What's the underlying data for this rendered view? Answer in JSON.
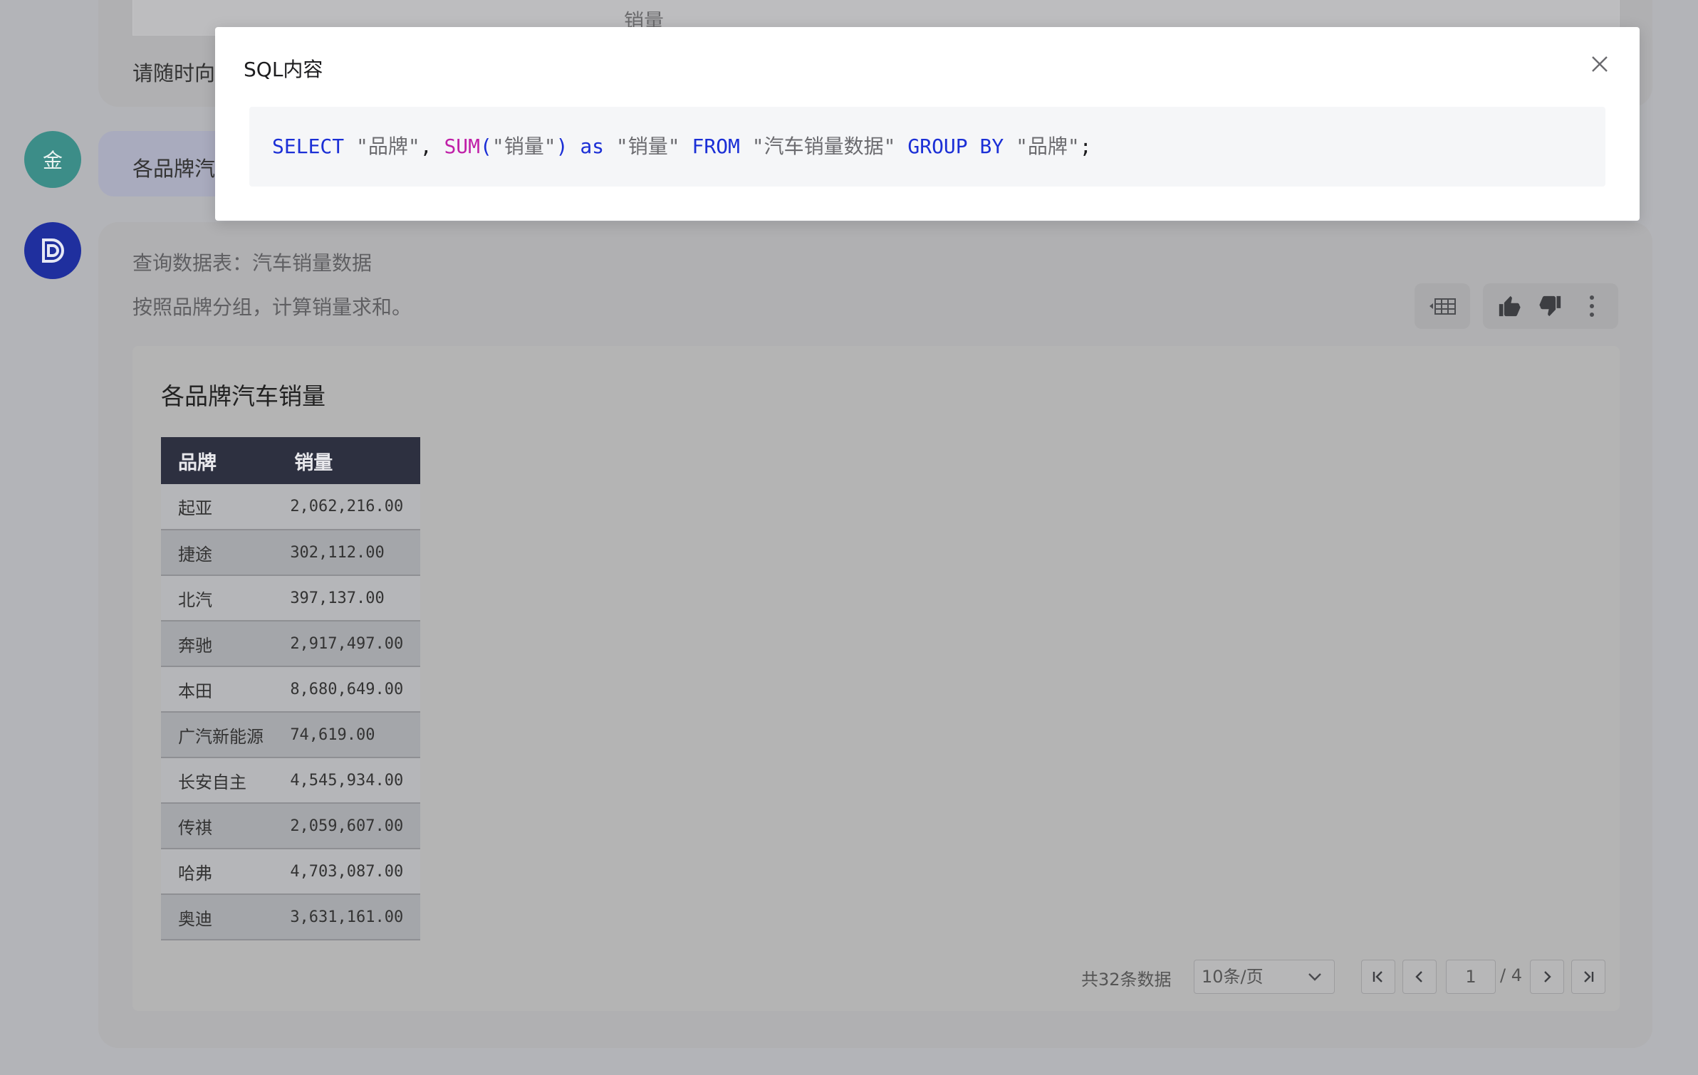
{
  "background": {
    "top_column_label": "销量",
    "top_hint": "请随时向我",
    "user_avatar": "金",
    "user_message": "各品牌汽车",
    "query_table": "查询数据表：汽车销量数据",
    "query_desc": "按照品牌分组，计算销量求和。"
  },
  "card": {
    "title": "各品牌汽车销量",
    "columns": [
      "品牌",
      "销量"
    ],
    "rows": [
      {
        "brand": "起亚",
        "sales": "2,062,216.00"
      },
      {
        "brand": "捷途",
        "sales": "302,112.00"
      },
      {
        "brand": "北汽",
        "sales": "397,137.00"
      },
      {
        "brand": "奔驰",
        "sales": "2,917,497.00"
      },
      {
        "brand": "本田",
        "sales": "8,680,649.00"
      },
      {
        "brand": "广汽新能源",
        "sales": "74,619.00"
      },
      {
        "brand": "长安自主",
        "sales": "4,545,934.00"
      },
      {
        "brand": "传祺",
        "sales": "2,059,607.00"
      },
      {
        "brand": "哈弗",
        "sales": "4,703,087.00"
      },
      {
        "brand": "奥迪",
        "sales": "3,631,161.00"
      }
    ]
  },
  "pagination": {
    "total": "共32条数据",
    "page_size": "10条/页",
    "current_page": "1",
    "total_pages": "/ 4"
  },
  "modal": {
    "title": "SQL内容",
    "sql_tokens": [
      {
        "t": "SELECT",
        "c": "kw"
      },
      {
        "t": " ",
        "c": "pun"
      },
      {
        "t": "\"品牌\"",
        "c": "str"
      },
      {
        "t": ", ",
        "c": "pun"
      },
      {
        "t": "SUM",
        "c": "fn"
      },
      {
        "t": "(",
        "c": "kw"
      },
      {
        "t": "\"销量\"",
        "c": "str"
      },
      {
        "t": ") ",
        "c": "kw"
      },
      {
        "t": "as",
        "c": "kw"
      },
      {
        "t": " ",
        "c": "pun"
      },
      {
        "t": "\"销量\"",
        "c": "str"
      },
      {
        "t": " ",
        "c": "pun"
      },
      {
        "t": "FROM",
        "c": "kw"
      },
      {
        "t": " ",
        "c": "pun"
      },
      {
        "t": "\"汽车销量数据\"",
        "c": "str"
      },
      {
        "t": " ",
        "c": "pun"
      },
      {
        "t": "GROUP BY",
        "c": "kw"
      },
      {
        "t": " ",
        "c": "pun"
      },
      {
        "t": "\"品牌\"",
        "c": "str"
      },
      {
        "t": ";",
        "c": "pun"
      }
    ]
  },
  "icons": {
    "table_toggle": "table-icon",
    "like": "thumbs-up-icon",
    "dislike": "thumbs-down-icon",
    "more": "more-vertical-icon",
    "close": "close-icon"
  },
  "colors": {
    "bot_avatar": "#1f2f9e",
    "user_avatar": "#3c8d88",
    "sql_keyword": "#1b2fd6",
    "sql_function": "#c020a8",
    "table_header": "#2d3040"
  }
}
